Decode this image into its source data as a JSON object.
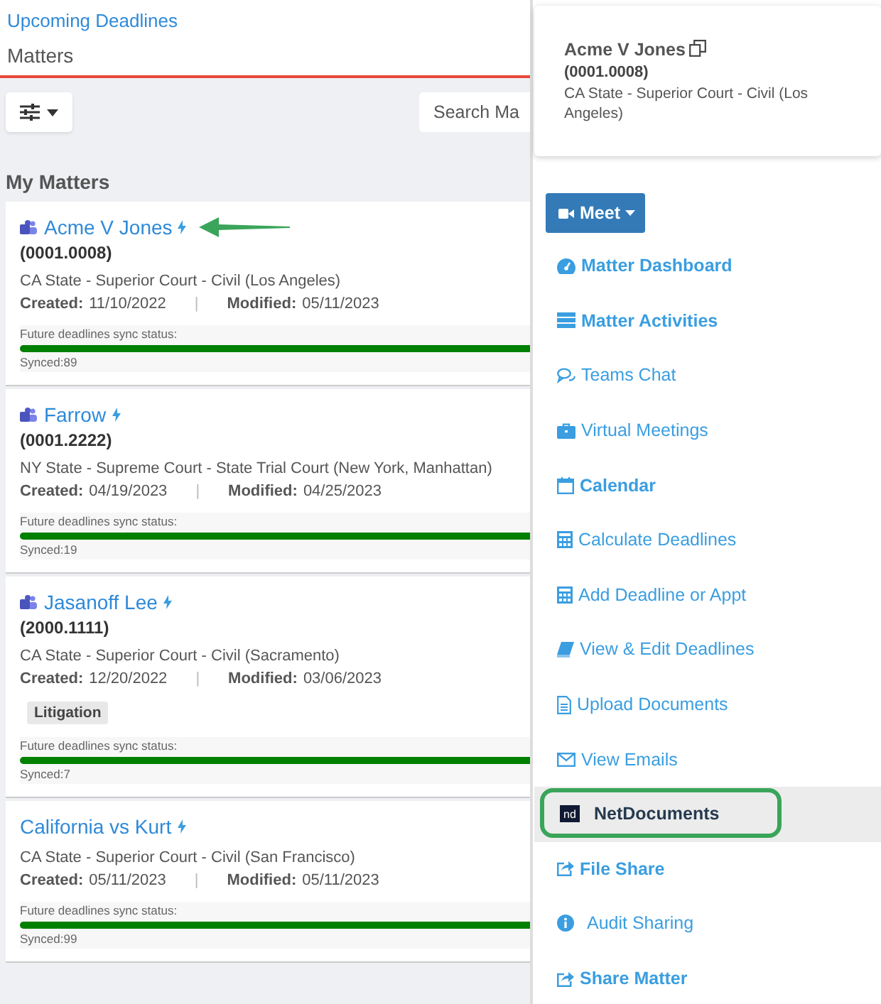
{
  "breadcrumb": "Upcoming Deadlines",
  "page_title": "Matters",
  "search": {
    "placeholder": "Search Ma"
  },
  "section_title": "My Matters",
  "matters": [
    {
      "name": "Acme V Jones",
      "number": "(0001.0008)",
      "court": "CA State - Superior Court - Civil (Los Angeles)",
      "created_label": "Created:",
      "created": "11/10/2022",
      "separator": "|",
      "modified_label": "Modified:",
      "modified": "05/11/2023",
      "sync_label": "Future deadlines sync status:",
      "level": 1,
      "synced": "Synced:89",
      "teams": true,
      "annotated": true
    },
    {
      "name": "Farrow",
      "number": "(0001.2222)",
      "court": "NY State - Supreme Court - State Trial Court (New York, Manhattan)",
      "created_label": "Created:",
      "created": "04/19/2023",
      "separator": "|",
      "modified_label": "Modified:",
      "modified": "04/25/2023",
      "sync_label": "Future deadlines sync status:",
      "level": 1,
      "synced": "Synced:19",
      "teams": true,
      "annotated": false
    },
    {
      "name": "Jasanoff Lee",
      "number": "(2000.1111)",
      "court": "CA State - Superior Court - Civil (Sacramento)",
      "created_label": "Created:",
      "created": "12/20/2022",
      "separator": "|",
      "modified_label": "Modified:",
      "modified": "03/06/2023",
      "tags": [
        "Litigation"
      ],
      "sync_label": "Future deadlines sync status:",
      "level": 1,
      "synced": "Synced:7",
      "teams": true,
      "annotated": false
    },
    {
      "name": "California vs Kurt",
      "court": "CA State - Superior Court - Civil (San Francisco)",
      "created_label": "Created:",
      "created": "05/11/2023",
      "separator": "|",
      "modified_label": "Modified:",
      "modified": "05/11/2023",
      "sync_label": "Future deadlines sync status:",
      "level": 1,
      "synced": "Synced:99",
      "teams": false,
      "annotated": false
    }
  ],
  "detail": {
    "name": "Acme V Jones",
    "number": "(0001.0008)",
    "court": "CA State - Superior Court - Civil (Los Angeles)"
  },
  "meet_button": "Meet",
  "menu": [
    {
      "label": "Matter Dashboard",
      "bold": true,
      "selected": false
    },
    {
      "label": "Matter Activities",
      "bold": true,
      "selected": false
    },
    {
      "label": "Teams Chat",
      "bold": false,
      "selected": false
    },
    {
      "label": "Virtual Meetings",
      "bold": false,
      "selected": false
    },
    {
      "label": "Calendar",
      "bold": true,
      "selected": false
    },
    {
      "label": "Calculate Deadlines",
      "bold": false,
      "selected": false
    },
    {
      "label": "Add Deadline or Appt",
      "bold": false,
      "selected": false
    },
    {
      "label": "View & Edit Deadlines",
      "bold": false,
      "selected": false
    },
    {
      "label": "Upload Documents",
      "bold": false,
      "selected": false
    },
    {
      "label": "View Emails",
      "bold": false,
      "selected": false
    },
    {
      "label": "NetDocuments",
      "bold": true,
      "selected": true,
      "logo_text": "nd"
    },
    {
      "label": "File Share",
      "bold": true,
      "selected": false
    },
    {
      "label": "Audit Sharing",
      "bold": false,
      "selected": false
    },
    {
      "label": "Share Matter",
      "bold": true,
      "selected": false
    }
  ]
}
